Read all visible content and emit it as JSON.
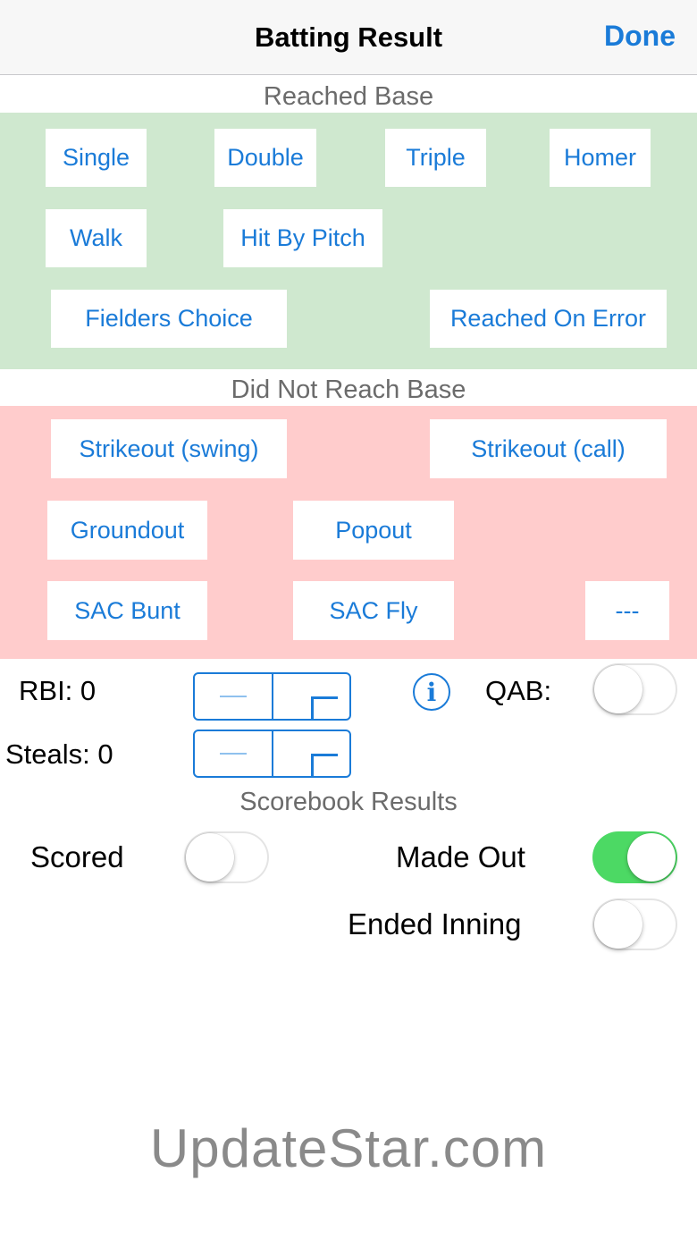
{
  "header": {
    "title": "Batting Result",
    "done_label": "Done"
  },
  "reached_base": {
    "label": "Reached Base",
    "buttons": {
      "single": "Single",
      "double": "Double",
      "triple": "Triple",
      "homer": "Homer",
      "walk": "Walk",
      "hit_by_pitch": "Hit By Pitch",
      "fielders_choice": "Fielders Choice",
      "reached_on_error": "Reached On Error"
    }
  },
  "not_reached": {
    "label": "Did Not Reach Base",
    "buttons": {
      "strikeout_swing": "Strikeout (swing)",
      "strikeout_call": "Strikeout (call)",
      "groundout": "Groundout",
      "popout": "Popout",
      "sac_bunt": "SAC Bunt",
      "sac_fly": "SAC Fly",
      "more": "---"
    }
  },
  "stats": {
    "rbi_label": "RBI: 0",
    "steals_label": "Steals: 0",
    "info_glyph": "i",
    "qab_label": "QAB:",
    "qab_on": false
  },
  "scorebook": {
    "label": "Scorebook Results",
    "scored_label": "Scored",
    "scored_on": false,
    "made_out_label": "Made Out",
    "made_out_on": true,
    "ended_inning_label": "Ended Inning",
    "ended_inning_on": false
  },
  "watermark": "UpdateStar.com",
  "colors": {
    "accent": "#1a7bd8",
    "reached_bg": "#cfe8cf",
    "not_reached_bg": "#ffcccc",
    "toggle_on": "#4cd964"
  },
  "icons": {
    "info": "info-circle-icon",
    "minus": "minus-icon",
    "plus": "plus-icon"
  }
}
